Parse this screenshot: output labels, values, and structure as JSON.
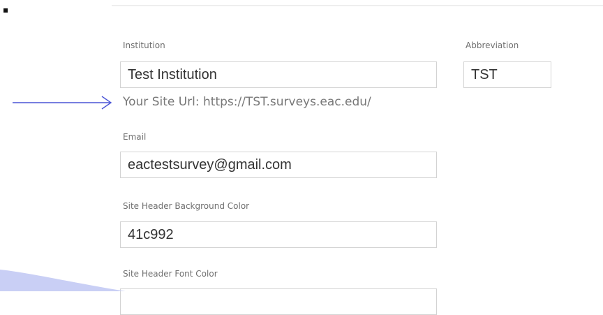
{
  "form": {
    "institution": {
      "label": "Institution",
      "value": "Test Institution"
    },
    "abbreviation": {
      "label": "Abbreviation",
      "value": "TST"
    },
    "site_url_text": "Your Site Url: https://TST.surveys.eac.edu/",
    "email": {
      "label": "Email",
      "value": "eactestsurvey@gmail.com"
    },
    "header_bg_color": {
      "label": "Site Header Background Color",
      "value": "41c992"
    },
    "header_font_color": {
      "label": "Site Header Font Color",
      "value": ""
    }
  },
  "annotation": {
    "arrow_color": "#4a54d6",
    "corner_shape_color": "#c9cff5"
  }
}
